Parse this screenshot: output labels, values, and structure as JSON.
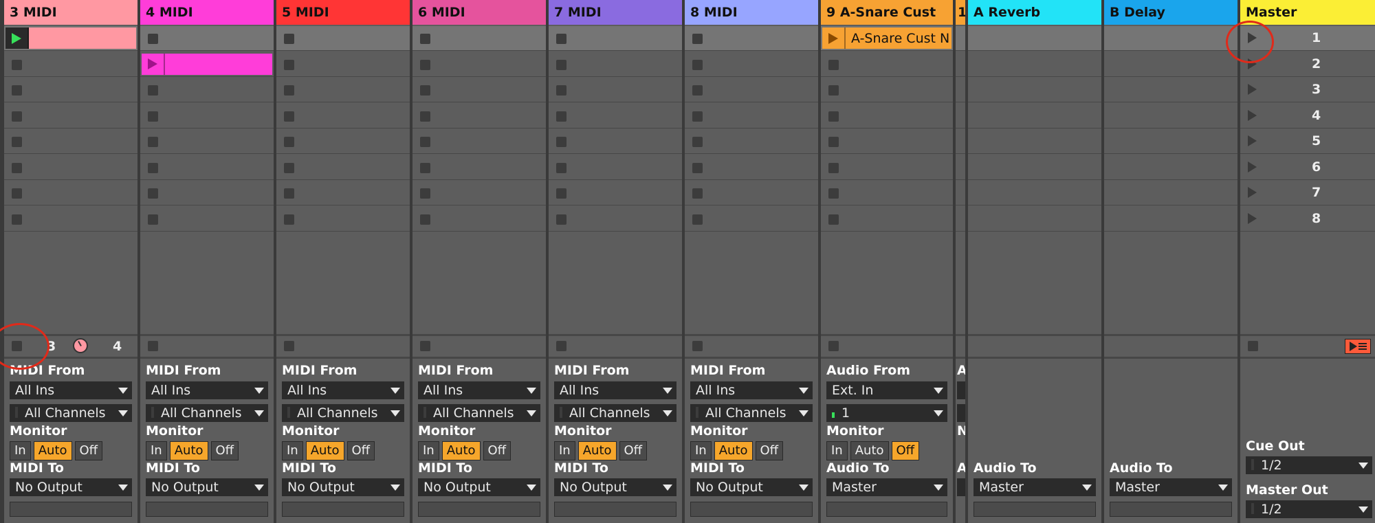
{
  "tracks": [
    {
      "name": "3 MIDI",
      "color": "#ff98a2",
      "input_label": "MIDI From",
      "input_source": "All Ins",
      "input_channel": "All Channels",
      "monitor_in": "In",
      "monitor_auto": "Auto",
      "monitor_off": "Off",
      "monitor_active": "auto",
      "output_label": "MIDI To",
      "output_target": "No Output"
    },
    {
      "name": "4 MIDI",
      "color": "#ff3dd9",
      "input_label": "MIDI From",
      "input_source": "All Ins",
      "input_channel": "All Channels",
      "monitor_in": "In",
      "monitor_auto": "Auto",
      "monitor_off": "Off",
      "monitor_active": "auto",
      "output_label": "MIDI To",
      "output_target": "No Output"
    },
    {
      "name": "5 MIDI",
      "color": "#ff3535",
      "input_label": "MIDI From",
      "input_source": "All Ins",
      "input_channel": "All Channels",
      "monitor_in": "In",
      "monitor_auto": "Auto",
      "monitor_off": "Off",
      "monitor_active": "auto",
      "output_label": "MIDI To",
      "output_target": "No Output"
    },
    {
      "name": "6 MIDI",
      "color": "#e5539d",
      "input_label": "MIDI From",
      "input_source": "All Ins",
      "input_channel": "All Channels",
      "monitor_in": "In",
      "monitor_auto": "Auto",
      "monitor_off": "Off",
      "monitor_active": "auto",
      "output_label": "MIDI To",
      "output_target": "No Output"
    },
    {
      "name": "7 MIDI",
      "color": "#8a6be0",
      "input_label": "MIDI From",
      "input_source": "All Ins",
      "input_channel": "All Channels",
      "monitor_in": "In",
      "monitor_auto": "Auto",
      "monitor_off": "Off",
      "monitor_active": "auto",
      "output_label": "MIDI To",
      "output_target": "No Output"
    },
    {
      "name": "8 MIDI",
      "color": "#97a5ff",
      "input_label": "MIDI From",
      "input_source": "All Ins",
      "input_channel": "All Channels",
      "monitor_in": "In",
      "monitor_auto": "Auto",
      "monitor_off": "Off",
      "monitor_active": "auto",
      "output_label": "MIDI To",
      "output_target": "No Output"
    },
    {
      "name": "9 A-Snare Cust",
      "color": "#f7a233",
      "input_label": "Audio From",
      "input_source": "Ext. In",
      "input_channel": "1",
      "monitor_in": "In",
      "monitor_auto": "Auto",
      "monitor_off": "Off",
      "monitor_active": "off",
      "output_label": "Audio To",
      "output_target": "Master"
    }
  ],
  "narrow_track": {
    "name": "1",
    "color": "#f7a233",
    "partial_label": "A",
    "partial_label_2": "N",
    "partial_label_3": "A"
  },
  "returns": [
    {
      "name": "A Reverb",
      "color": "#22e3f7",
      "output_label": "Audio To",
      "output_target": "Master"
    },
    {
      "name": "B Delay",
      "color": "#1aa5ec",
      "output_label": "Audio To",
      "output_target": "Master"
    }
  ],
  "master": {
    "name": "Master",
    "color": "#fbee35",
    "cue_label": "Cue Out",
    "cue_value": "1/2",
    "out_label": "Master Out",
    "out_value": "1/2"
  },
  "clips": [
    {
      "track": 0,
      "scene": 0,
      "color": "#ff98a2",
      "name": "",
      "playing": true
    },
    {
      "track": 1,
      "scene": 1,
      "color": "#ff3dd9",
      "name": "",
      "playing": false
    },
    {
      "track": 6,
      "scene": 0,
      "color": "#f7a233",
      "name": "A-Snare Cust N",
      "playing": false
    }
  ],
  "scenes": [
    "1",
    "2",
    "3",
    "4",
    "5",
    "6",
    "7",
    "8"
  ],
  "track1_controls": {
    "left_num": "3",
    "right_num": "4",
    "knob_color": "#ff98a2"
  }
}
